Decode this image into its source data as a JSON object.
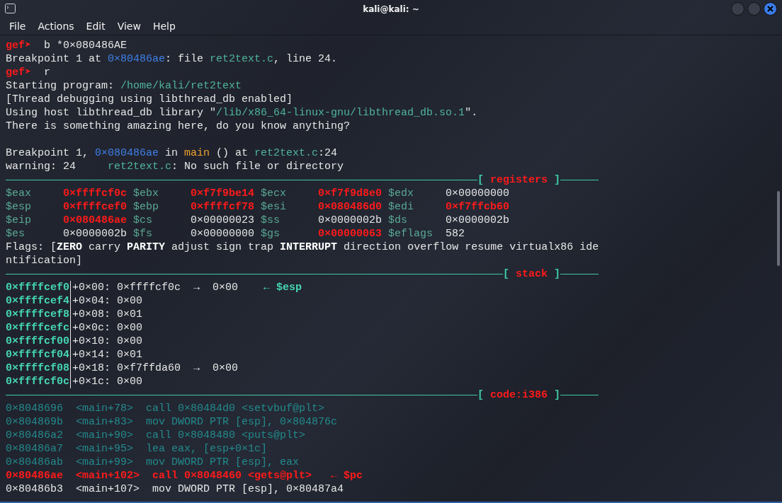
{
  "window": {
    "title": "kali@kali: ~"
  },
  "menu": [
    "File",
    "Actions",
    "Edit",
    "View",
    "Help"
  ],
  "console": [
    {
      "kind": "prompt",
      "prompt": "gef➤",
      "command": "b *0×080486AE"
    },
    {
      "kind": "output",
      "segments": [
        {
          "text": "Breakpoint 1 at ",
          "kind": "plain"
        },
        {
          "text": "0×80486ae",
          "kind": "address"
        },
        {
          "text": ": file ",
          "kind": "plain"
        },
        {
          "text": "ret2text.c",
          "kind": "path"
        },
        {
          "text": ", line 24.",
          "kind": "plain"
        }
      ]
    },
    {
      "kind": "prompt",
      "prompt": "gef➤",
      "command": "r"
    },
    {
      "kind": "output",
      "segments": [
        {
          "text": "Starting program: ",
          "kind": "plain"
        },
        {
          "text": "/home/kali/ret2text",
          "kind": "path"
        }
      ]
    },
    {
      "kind": "output",
      "segments": [
        {
          "text": "[Thread debugging using libthread_db enabled]",
          "kind": "plain"
        }
      ]
    },
    {
      "kind": "output",
      "segments": [
        {
          "text": "Using host libthread_db library \"",
          "kind": "plain"
        },
        {
          "text": "/lib/x86_64-linux-gnu/libthread_db.so.1",
          "kind": "path"
        },
        {
          "text": "\".",
          "kind": "plain"
        }
      ]
    },
    {
      "kind": "output",
      "segments": [
        {
          "text": "There is something amazing here, do you know anything?",
          "kind": "plain"
        }
      ]
    },
    {
      "kind": "blank"
    },
    {
      "kind": "output",
      "segments": [
        {
          "text": "Breakpoint 1, ",
          "kind": "plain"
        },
        {
          "text": "0×080486ae",
          "kind": "address"
        },
        {
          "text": " in ",
          "kind": "plain"
        },
        {
          "text": "main",
          "kind": "function"
        },
        {
          "text": " () at ",
          "kind": "plain"
        },
        {
          "text": "ret2text.c",
          "kind": "path"
        },
        {
          "text": ":24",
          "kind": "plain"
        }
      ]
    },
    {
      "kind": "output",
      "segments": [
        {
          "text": "warning: 24     ",
          "kind": "plain"
        },
        {
          "text": "ret2text.c",
          "kind": "path"
        },
        {
          "text": ": No such file or directory",
          "kind": "plain"
        }
      ]
    }
  ],
  "registers": {
    "left_bracket": "[",
    "title": "registers",
    "right_bracket": "]",
    "items": [
      {
        "name": "$eax",
        "value": "0×ffffcf0c",
        "changed": true
      },
      {
        "name": "$ebx",
        "value": "0×f7f9be14",
        "changed": true
      },
      {
        "name": "$ecx",
        "value": "0×f7f9d8e0",
        "changed": true
      },
      {
        "name": "$edx",
        "value": "0×00000000",
        "changed": false
      },
      {
        "name": "$esp",
        "value": "0×ffffcef0",
        "changed": true
      },
      {
        "name": "$ebp",
        "value": "0×ffffcf78",
        "changed": true
      },
      {
        "name": "$esi",
        "value": "0×080486d0",
        "changed": true
      },
      {
        "name": "$edi",
        "value": "0×f7ffcb60",
        "changed": true
      },
      {
        "name": "$eip",
        "value": "0×080486ae",
        "changed": true
      },
      {
        "name": "$cs",
        "value": "0×00000023",
        "changed": false
      },
      {
        "name": "$ss",
        "value": "0×0000002b",
        "changed": false
      },
      {
        "name": "$ds",
        "value": "0×0000002b",
        "changed": false
      },
      {
        "name": "$es",
        "value": "0×0000002b",
        "changed": false
      },
      {
        "name": "$fs",
        "value": "0×00000000",
        "changed": false
      },
      {
        "name": "$gs",
        "value": "0×00000063",
        "changed": true
      },
      {
        "name": "$eflags",
        "value": "582",
        "changed": false
      }
    ],
    "flags": [
      "Flags: [**ZERO** carry **PARITY** adjust sign trap **INTERRUPT** direction overflow resume virtualx86 ide",
      "ntification]"
    ]
  },
  "stack": {
    "left_bracket": "[",
    "title": "stack",
    "right_bracket": "]",
    "rows": [
      {
        "address": "0×ffffcef0",
        "content": "+0×00: 0×ffffcf0c  →  0×00",
        "note": "← $esp"
      },
      {
        "address": "0×ffffcef4",
        "content": "+0×04: 0×00"
      },
      {
        "address": "0×ffffcef8",
        "content": "+0×08: 0×01"
      },
      {
        "address": "0×ffffcefc",
        "content": "+0×0c: 0×00"
      },
      {
        "address": "0×ffffcf00",
        "content": "+0×10: 0×00"
      },
      {
        "address": "0×ffffcf04",
        "content": "+0×14: 0×01"
      },
      {
        "address": "0×ffffcf08",
        "content": "+0×18: 0×f7ffda60  →  0×00"
      },
      {
        "address": "0×ffffcf0c",
        "content": "+0×1c: 0×00"
      }
    ]
  },
  "code": {
    "left_bracket": "[",
    "title": "code:i386",
    "right_bracket": "]",
    "rows": [
      {
        "address": "0×8048696",
        "symbol": "<main+78>",
        "instruction": "call 0×80484d0 <setvbuf@plt>",
        "kind": "past"
      },
      {
        "address": "0×804869b",
        "symbol": "<main+83>",
        "instruction": "mov DWORD PTR [esp], 0×804876c",
        "kind": "past"
      },
      {
        "address": "0×80486a2",
        "symbol": "<main+90>",
        "instruction": "call 0×8048480 <puts@plt>",
        "kind": "past"
      },
      {
        "address": "0×80486a7",
        "symbol": "<main+95>",
        "instruction": "lea eax, [esp+0×1c]",
        "kind": "past"
      },
      {
        "address": "0×80486ab",
        "symbol": "<main+99>",
        "instruction": "mov DWORD PTR [esp], eax",
        "kind": "past"
      },
      {
        "address": "0×80486ae",
        "symbol": "<main+102>",
        "instruction": "call 0×8048460 <gets@plt>",
        "kind": "current",
        "note": "← $pc"
      },
      {
        "address": "0×80486b3",
        "symbol": "<main+107>",
        "instruction": "mov DWORD PTR [esp], 0×80487a4",
        "kind": "next"
      }
    ]
  }
}
